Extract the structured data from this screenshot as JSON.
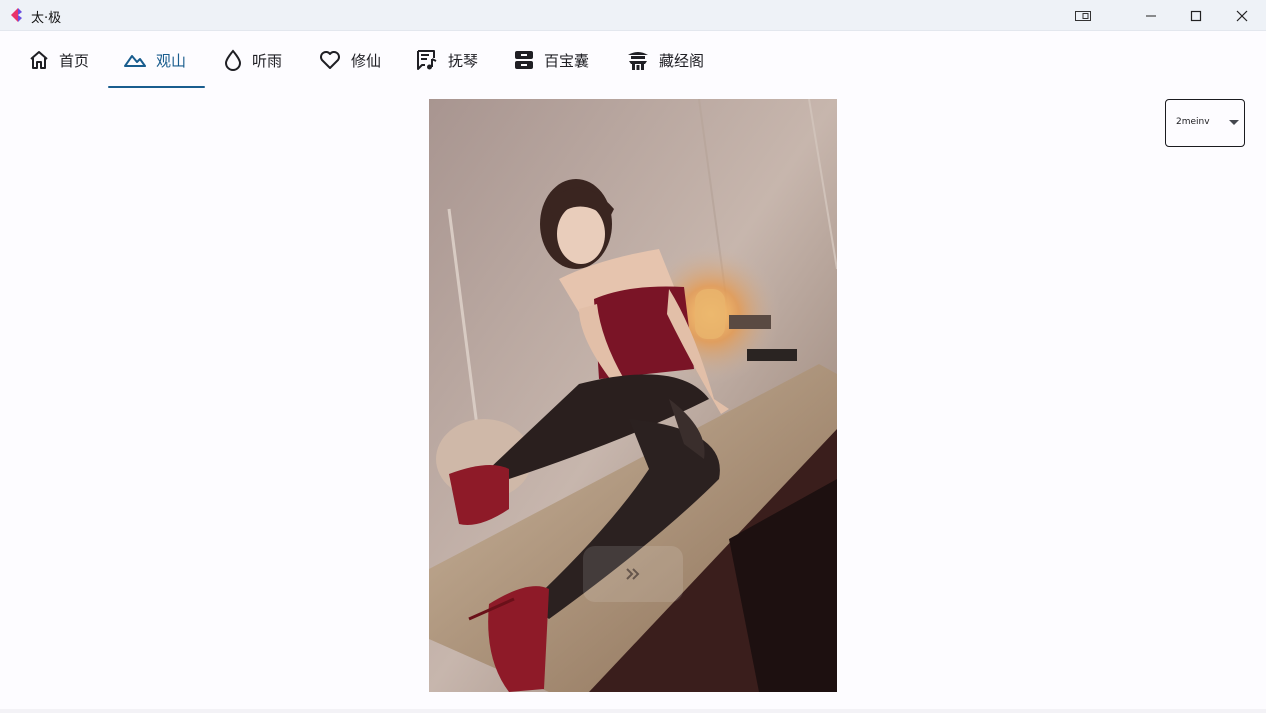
{
  "window": {
    "title": "太·极",
    "extra_icon": "tablet-icon",
    "min_icon": "minimize-icon",
    "max_icon": "maximize-icon",
    "close_icon": "close-icon"
  },
  "nav": {
    "active_index": 1,
    "tabs": [
      {
        "label": "首页",
        "icon": "home-icon"
      },
      {
        "label": "观山",
        "icon": "mountain-icon"
      },
      {
        "label": "听雨",
        "icon": "water-drop-icon"
      },
      {
        "label": "修仙",
        "icon": "heart-icon"
      },
      {
        "label": "抚琴",
        "icon": "music-note-icon"
      },
      {
        "label": "百宝囊",
        "icon": "inbox-icon"
      },
      {
        "label": "藏经阁",
        "icon": "temple-icon"
      }
    ]
  },
  "viewer": {
    "image_subject": "photo",
    "next_icon": "double-chevron-right-icon"
  },
  "source": {
    "selected": "2meinv",
    "caret_icon": "caret-down-icon"
  },
  "colors": {
    "accent": "#195d8e",
    "titlebar": "#eef2f7",
    "background": "#fdfcff"
  }
}
